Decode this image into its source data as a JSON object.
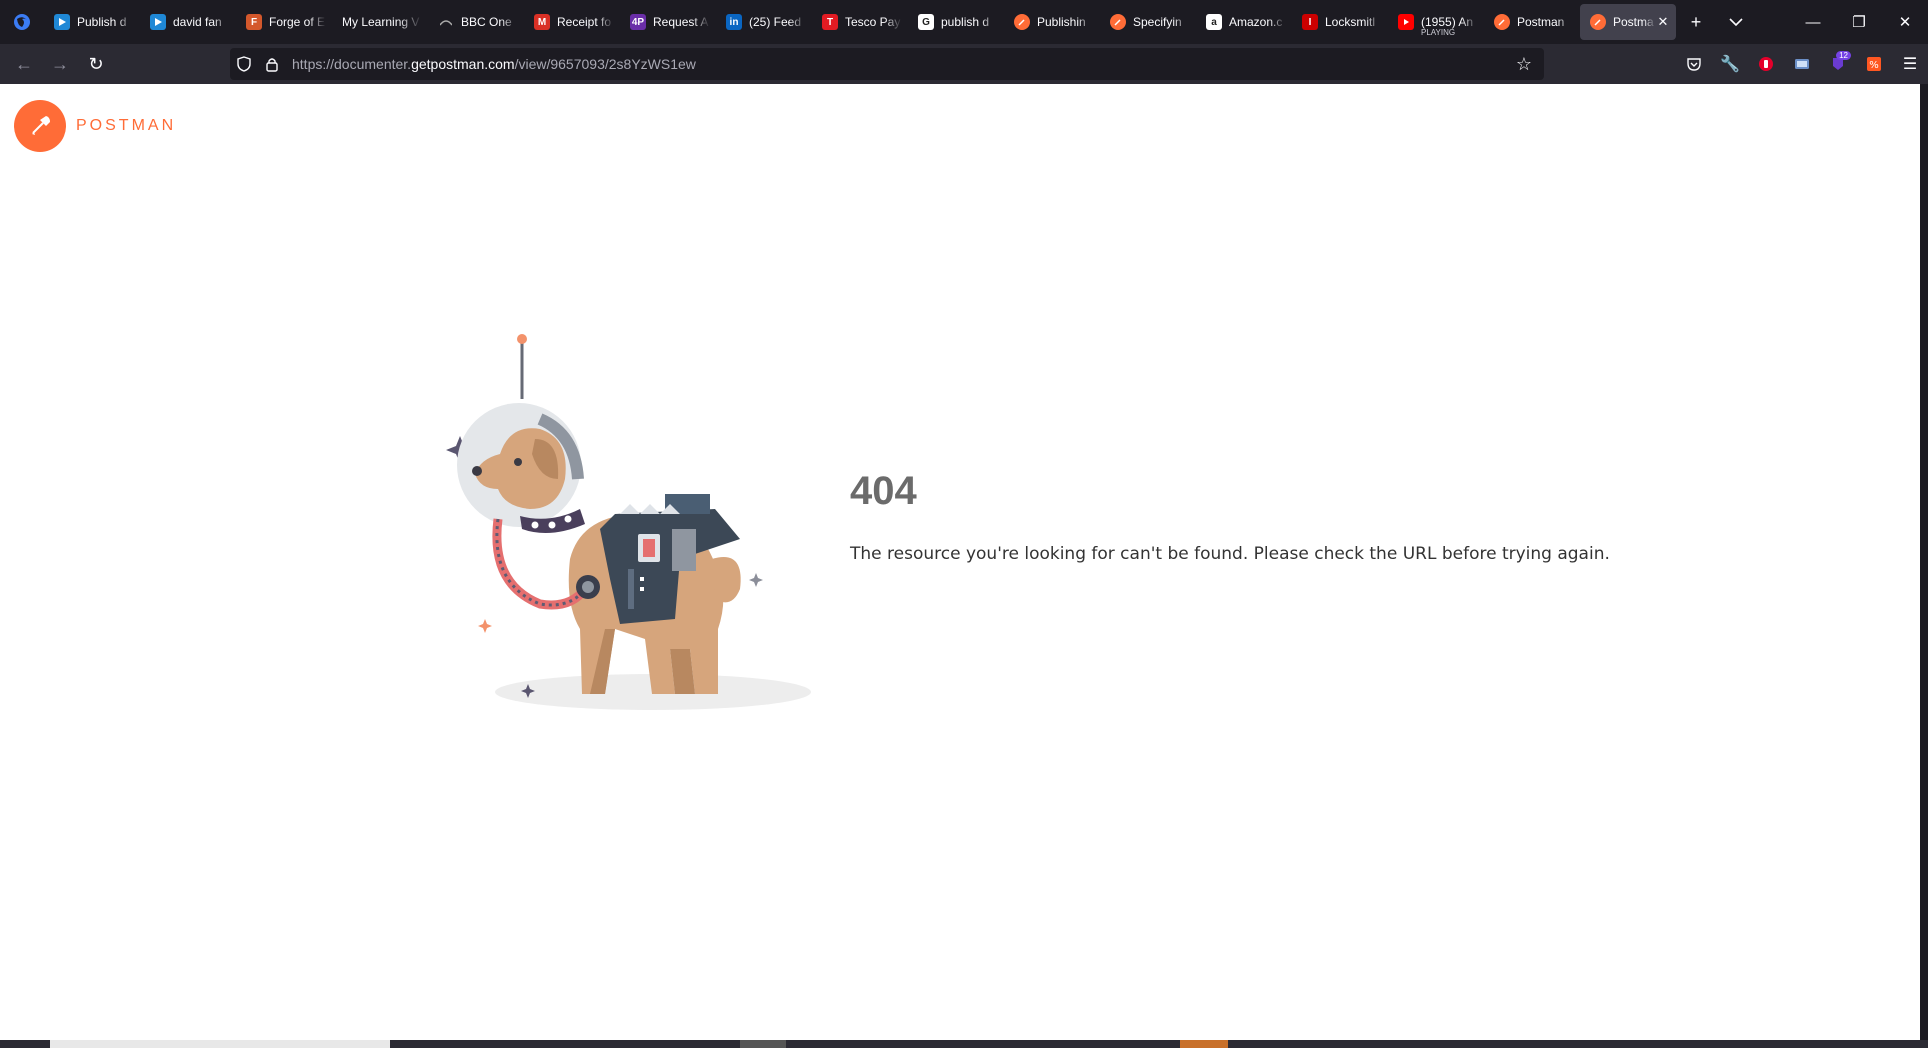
{
  "browser": {
    "tabs": [
      {
        "label": "Publish d",
        "favicon": "video-icon",
        "color": "#1f88d6"
      },
      {
        "label": "david fan",
        "favicon": "video-icon",
        "color": "#1f88d6"
      },
      {
        "label": "Forge of E",
        "favicon": "F",
        "color": "#d4582c"
      },
      {
        "label": "My Learning V",
        "favicon": "",
        "color": "#1c1b22"
      },
      {
        "label": "BBC One",
        "favicon": "bbc-icon",
        "color": "#444"
      },
      {
        "label": "Receipt fo",
        "favicon": "M",
        "color": "#d93025"
      },
      {
        "label": "Request A",
        "favicon": "4P",
        "color": "#6a2ea8"
      },
      {
        "label": "(25) Feed",
        "favicon": "in",
        "color": "#0a66c2"
      },
      {
        "label": "Tesco Pay",
        "favicon": "T",
        "color": "#e21b23"
      },
      {
        "label": "publish d",
        "favicon": "G",
        "color": "#ffffff"
      },
      {
        "label": "Publishin",
        "favicon": "postman-icon",
        "color": "#ff6c37"
      },
      {
        "label": "Specifyin",
        "favicon": "postman-icon",
        "color": "#ff6c37"
      },
      {
        "label": "Amazon.c",
        "favicon": "a",
        "color": "#ffffff"
      },
      {
        "label": "Locksmitl",
        "favicon": "I",
        "color": "#c00"
      },
      {
        "label": "(1955) An",
        "sub": "PLAYING",
        "favicon": "youtube-icon",
        "color": "#ff0000"
      },
      {
        "label": "Postman",
        "favicon": "postman-icon",
        "color": "#ff6c37"
      },
      {
        "label": "Postma",
        "favicon": "postman-icon",
        "color": "#ff6c37",
        "active": true
      }
    ],
    "url_prefix": "https://documenter.",
    "url_domain": "getpostman.com",
    "url_path": "/view/9657093/2s8YzWS1ew",
    "ext_badge": "12"
  },
  "page": {
    "logo_text": "POSTMAN",
    "error_code": "404",
    "error_message": "The resource you're looking for can't be found. Please check the URL before trying again."
  }
}
